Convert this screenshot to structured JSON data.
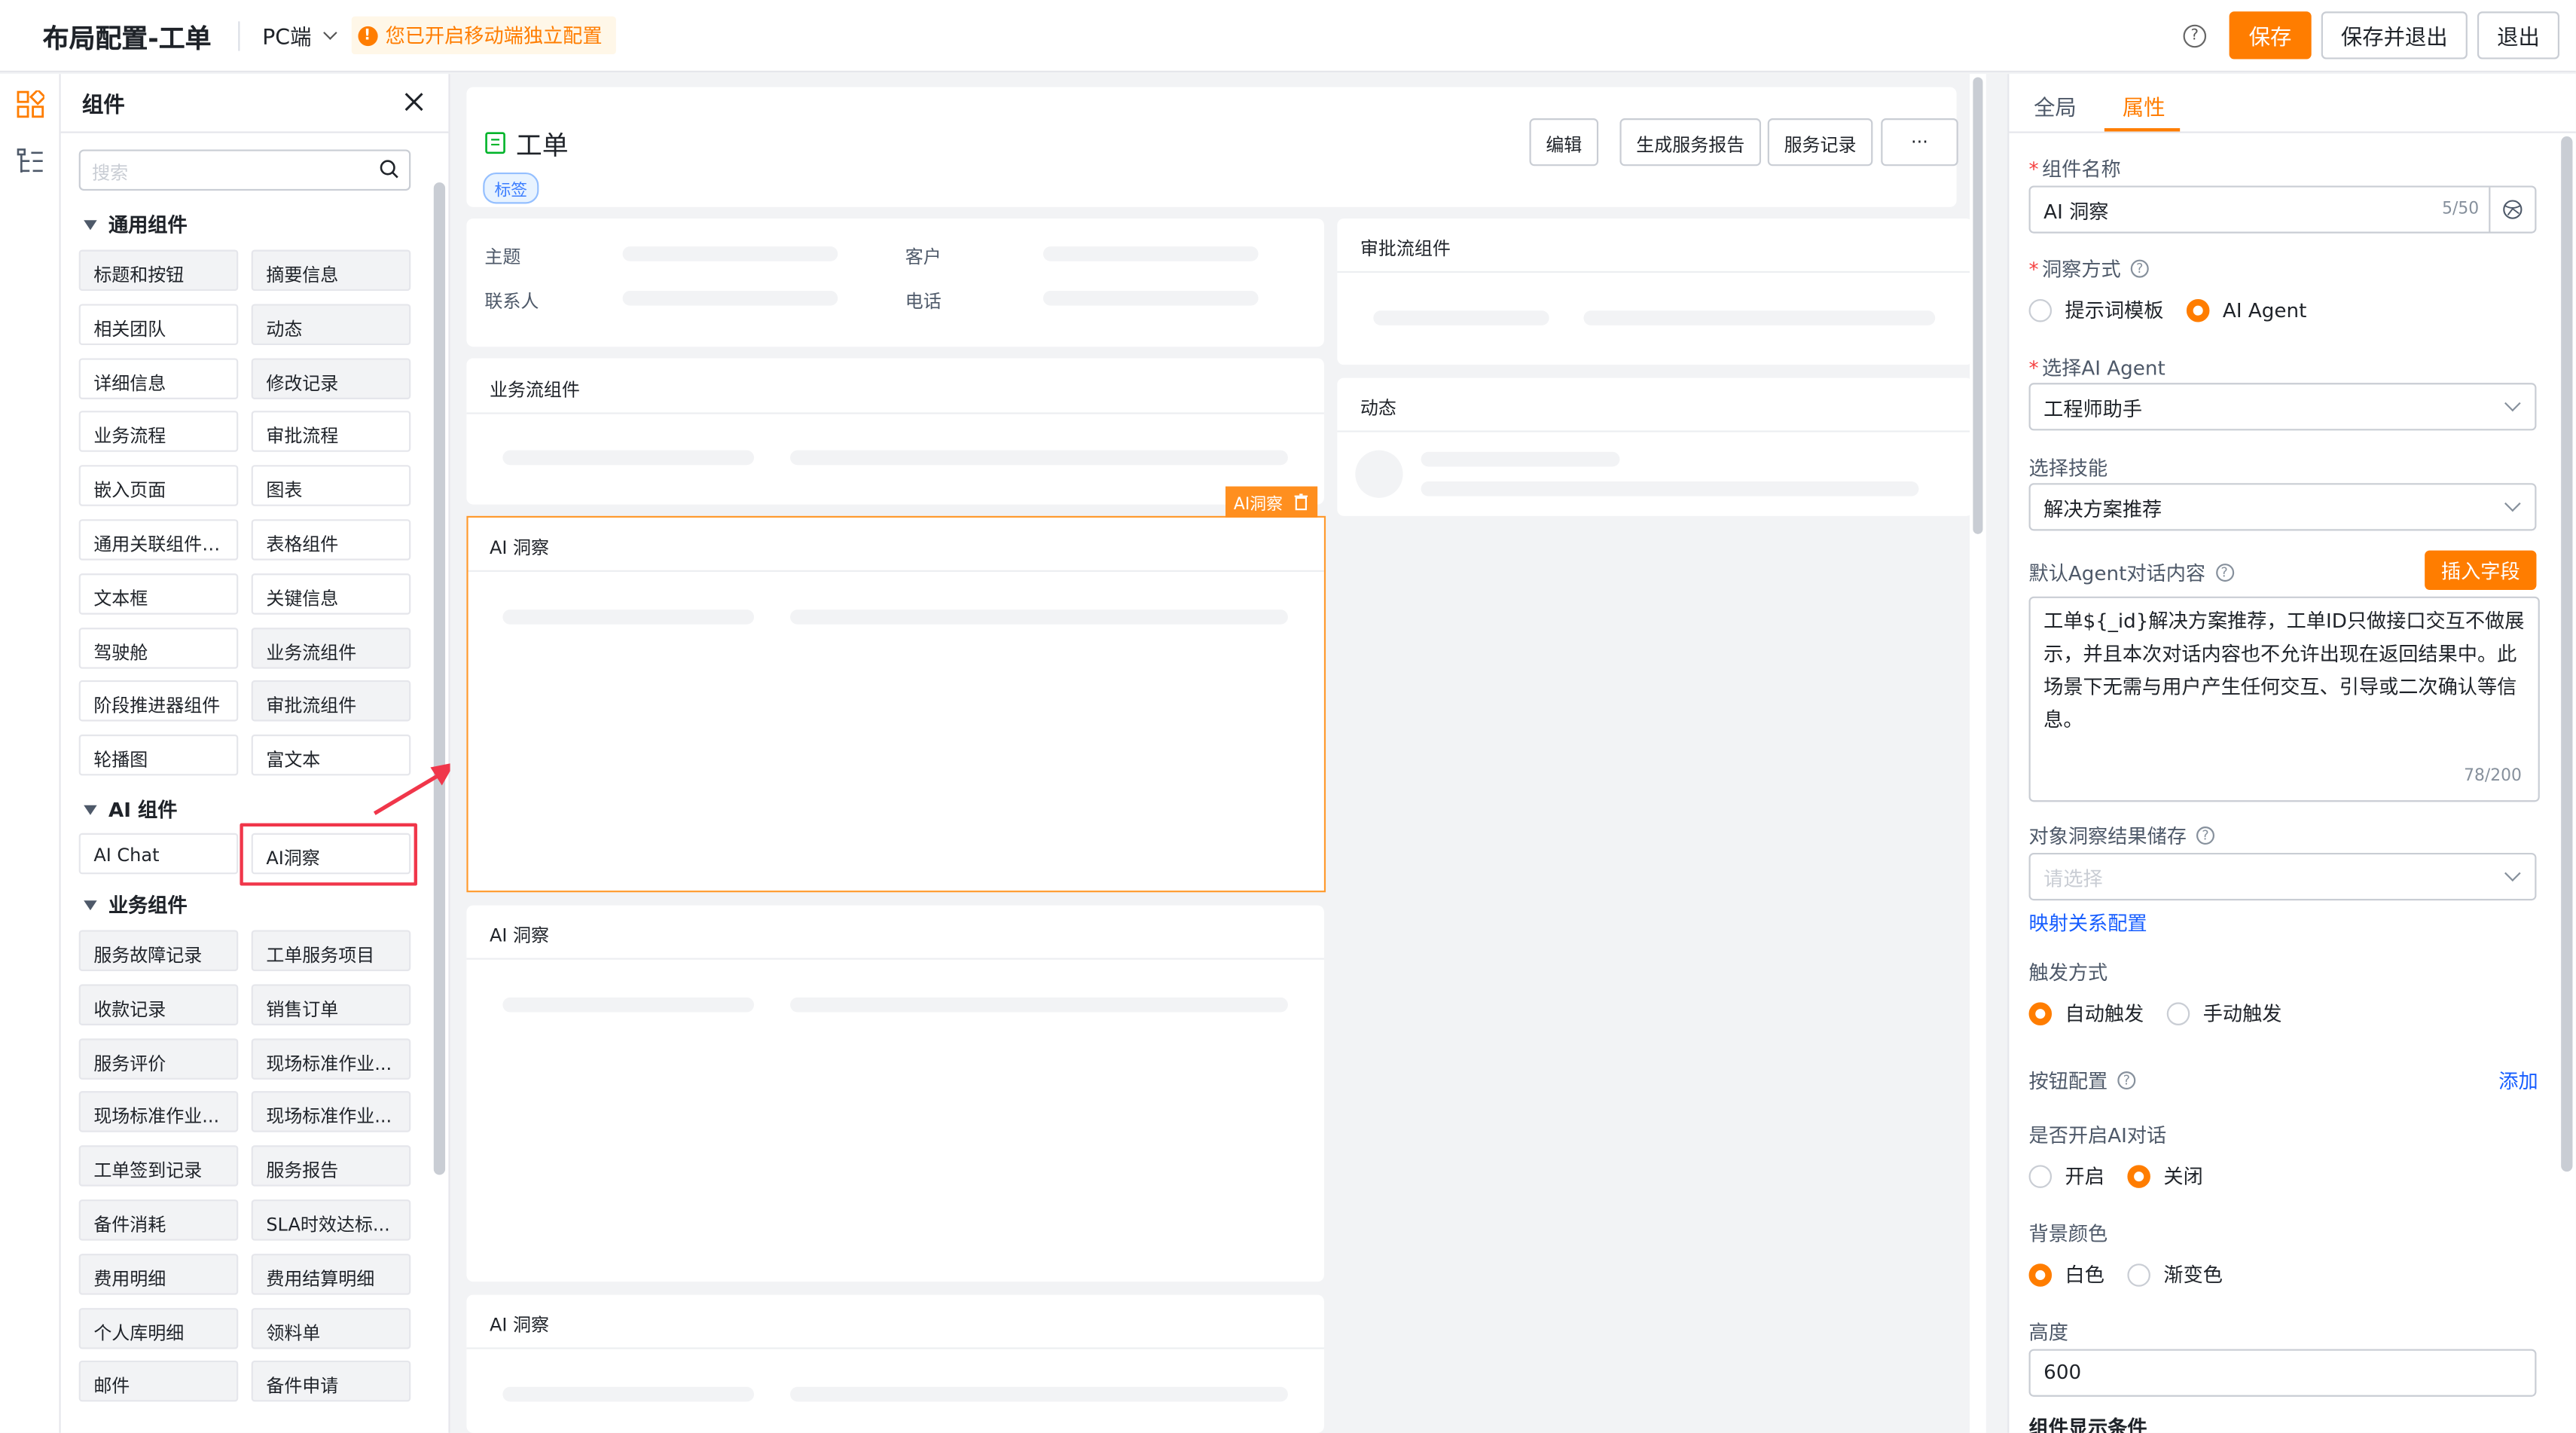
{
  "header": {
    "title": "布局配置-工单",
    "platform": "PC端",
    "notice": "您已开启移动端独立配置",
    "save": "保存",
    "save_exit": "保存并退出",
    "exit": "退出"
  },
  "components": {
    "title": "组件",
    "search_placeholder": "搜索",
    "groups": [
      {
        "name": "通用组件",
        "items": [
          "标题和按钮",
          "摘要信息",
          "相关团队",
          "动态",
          "详细信息",
          "修改记录",
          "业务流程",
          "审批流程",
          "嵌入页面",
          "图表",
          "通用关联组件(...",
          "表格组件",
          "文本框",
          "关键信息",
          "驾驶舱",
          "业务流组件",
          "阶段推进器组件",
          "审批流组件",
          "轮播图",
          "富文本"
        ]
      },
      {
        "name": "AI 组件",
        "items": [
          "AI Chat",
          "AI洞察"
        ]
      },
      {
        "name": "业务组件",
        "items": [
          "服务故障记录",
          "工单服务项目",
          "收款记录",
          "销售订单",
          "服务评价",
          "现场标准作业...",
          "现场标准作业...",
          "现场标准作业...",
          "工单签到记录",
          "服务报告",
          "备件消耗",
          "SLA时效达标...",
          "费用明细",
          "费用结算明细",
          "个人库明细",
          "领料单",
          "邮件",
          "备件申请"
        ]
      }
    ]
  },
  "canvas": {
    "page_title": "工单",
    "tag": "标签",
    "buttons": [
      "编辑",
      "生成服务报告",
      "服务记录",
      "···"
    ],
    "summary": {
      "subject": "主题",
      "contact": "联系人",
      "customer": "客户",
      "phone": "电话"
    },
    "cards": {
      "bizflow": "业务流组件",
      "ai1": "AI 洞察",
      "ai2": "AI 洞察",
      "ai3": "AI 洞察",
      "approval": "审批流组件",
      "activity": "动态"
    },
    "selected_tag": "AI洞察"
  },
  "props": {
    "tab_global": "全局",
    "tab_attr": "属性",
    "name_label": "组件名称",
    "name_value": "AI 洞察",
    "name_count": "5/50",
    "mode_label": "洞察方式",
    "mode_opt1": "提示词模板",
    "mode_opt2": "AI Agent",
    "agent_label": "选择AI Agent",
    "agent_value": "工程师助手",
    "skill_label": "选择技能",
    "skill_value": "解决方案推荐",
    "default_label": "默认Agent对话内容",
    "insert_btn": "插入字段",
    "default_text": "工单${_id}解决方案推荐，工单ID只做接口交互不做展示，并且本次对话内容也不允许出现在返回结果中。此场景下无需与用户产生任何交互、引导或二次确认等信息。",
    "default_count": "78/200",
    "store_label": "对象洞察结果储存",
    "store_placeholder": "请选择",
    "mapping_link": "映射关系配置",
    "trigger_label": "触发方式",
    "trigger_opt1": "自动触发",
    "trigger_opt2": "手动触发",
    "button_label": "按钮配置",
    "add_link": "添加",
    "ai_dialog_label": "是否开启AI对话",
    "ai_opt1": "开启",
    "ai_opt2": "关闭",
    "bg_label": "背景颜色",
    "bg_opt1": "白色",
    "bg_opt2": "渐变色",
    "height_label": "高度",
    "height_value": "600",
    "cond_label": "组件显示条件"
  }
}
